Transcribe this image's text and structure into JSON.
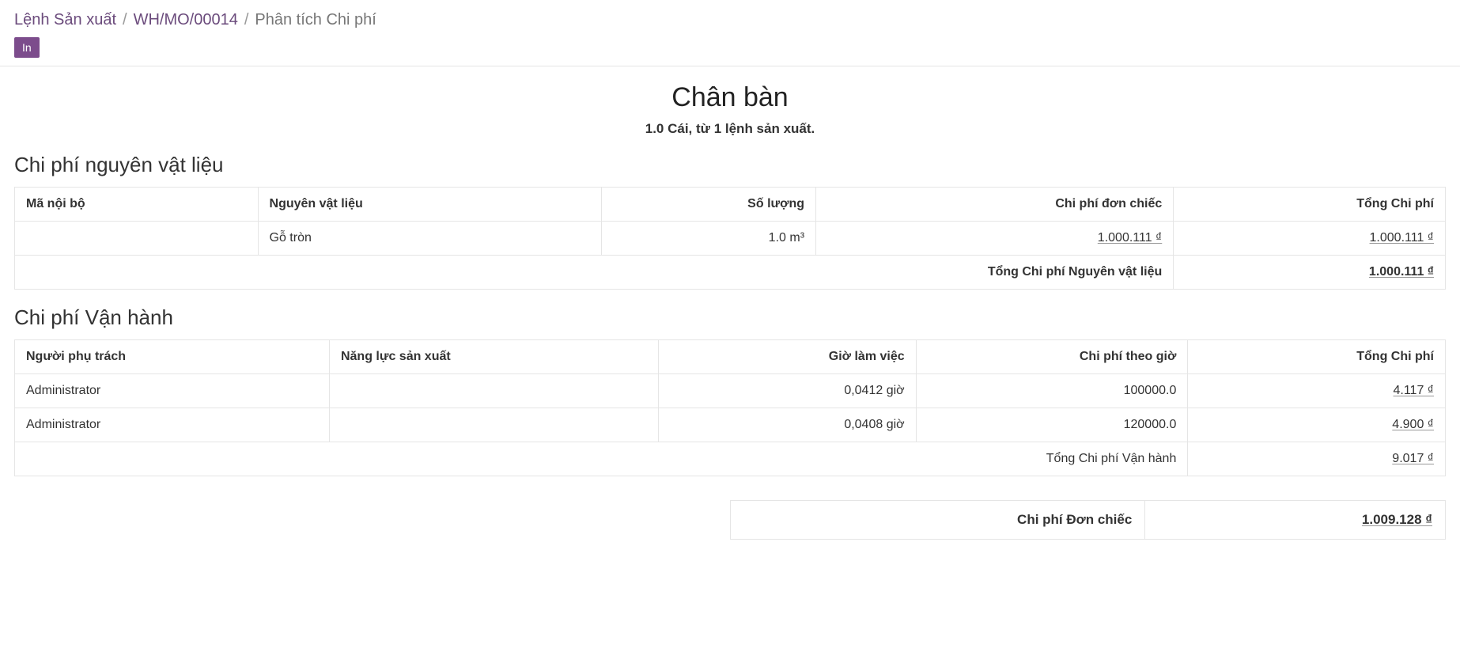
{
  "breadcrumb": {
    "items": [
      {
        "label": "Lệnh Sản xuất"
      },
      {
        "label": "WH/MO/00014"
      }
    ],
    "current": "Phân tích Chi phí"
  },
  "toolbar": {
    "print_label": "In"
  },
  "header": {
    "title": "Chân bàn",
    "subtitle": "1.0 Cái, từ 1 lệnh sản xuất."
  },
  "materials": {
    "title": "Chi phí nguyên vật liệu",
    "columns": {
      "internal_ref": "Mã nội bộ",
      "material": "Nguyên vật liệu",
      "qty": "Số lượng",
      "unit_cost": "Chi phí đơn chiếc",
      "total_cost": "Tổng Chi phí"
    },
    "rows": [
      {
        "internal_ref": "",
        "material": "Gỗ tròn",
        "qty": "1.0 m³",
        "unit_cost": "1.000.111 ₫",
        "total_cost": "1.000.111 ₫"
      }
    ],
    "summary_label": "Tổng Chi phí Nguyên vật liệu",
    "summary_value": "1.000.111 ₫"
  },
  "operations": {
    "title": "Chi phí Vận hành",
    "columns": {
      "responsible": "Người phụ trách",
      "capacity": "Năng lực sản xuất",
      "hours": "Giờ làm việc",
      "hour_cost": "Chi phí theo giờ",
      "total_cost": "Tổng Chi phí"
    },
    "rows": [
      {
        "responsible": "Administrator",
        "capacity": "",
        "hours": "0,0412 giờ",
        "hour_cost": "100000.0",
        "total_cost": "4.117 ₫"
      },
      {
        "responsible": "Administrator",
        "capacity": "",
        "hours": "0,0408 giờ",
        "hour_cost": "120000.0",
        "total_cost": "4.900 ₫"
      }
    ],
    "summary_label": "Tổng Chi phí Vận hành",
    "summary_value": "9.017 ₫"
  },
  "final": {
    "label": "Chi phí Đơn chiếc",
    "value": "1.009.128 ₫"
  }
}
